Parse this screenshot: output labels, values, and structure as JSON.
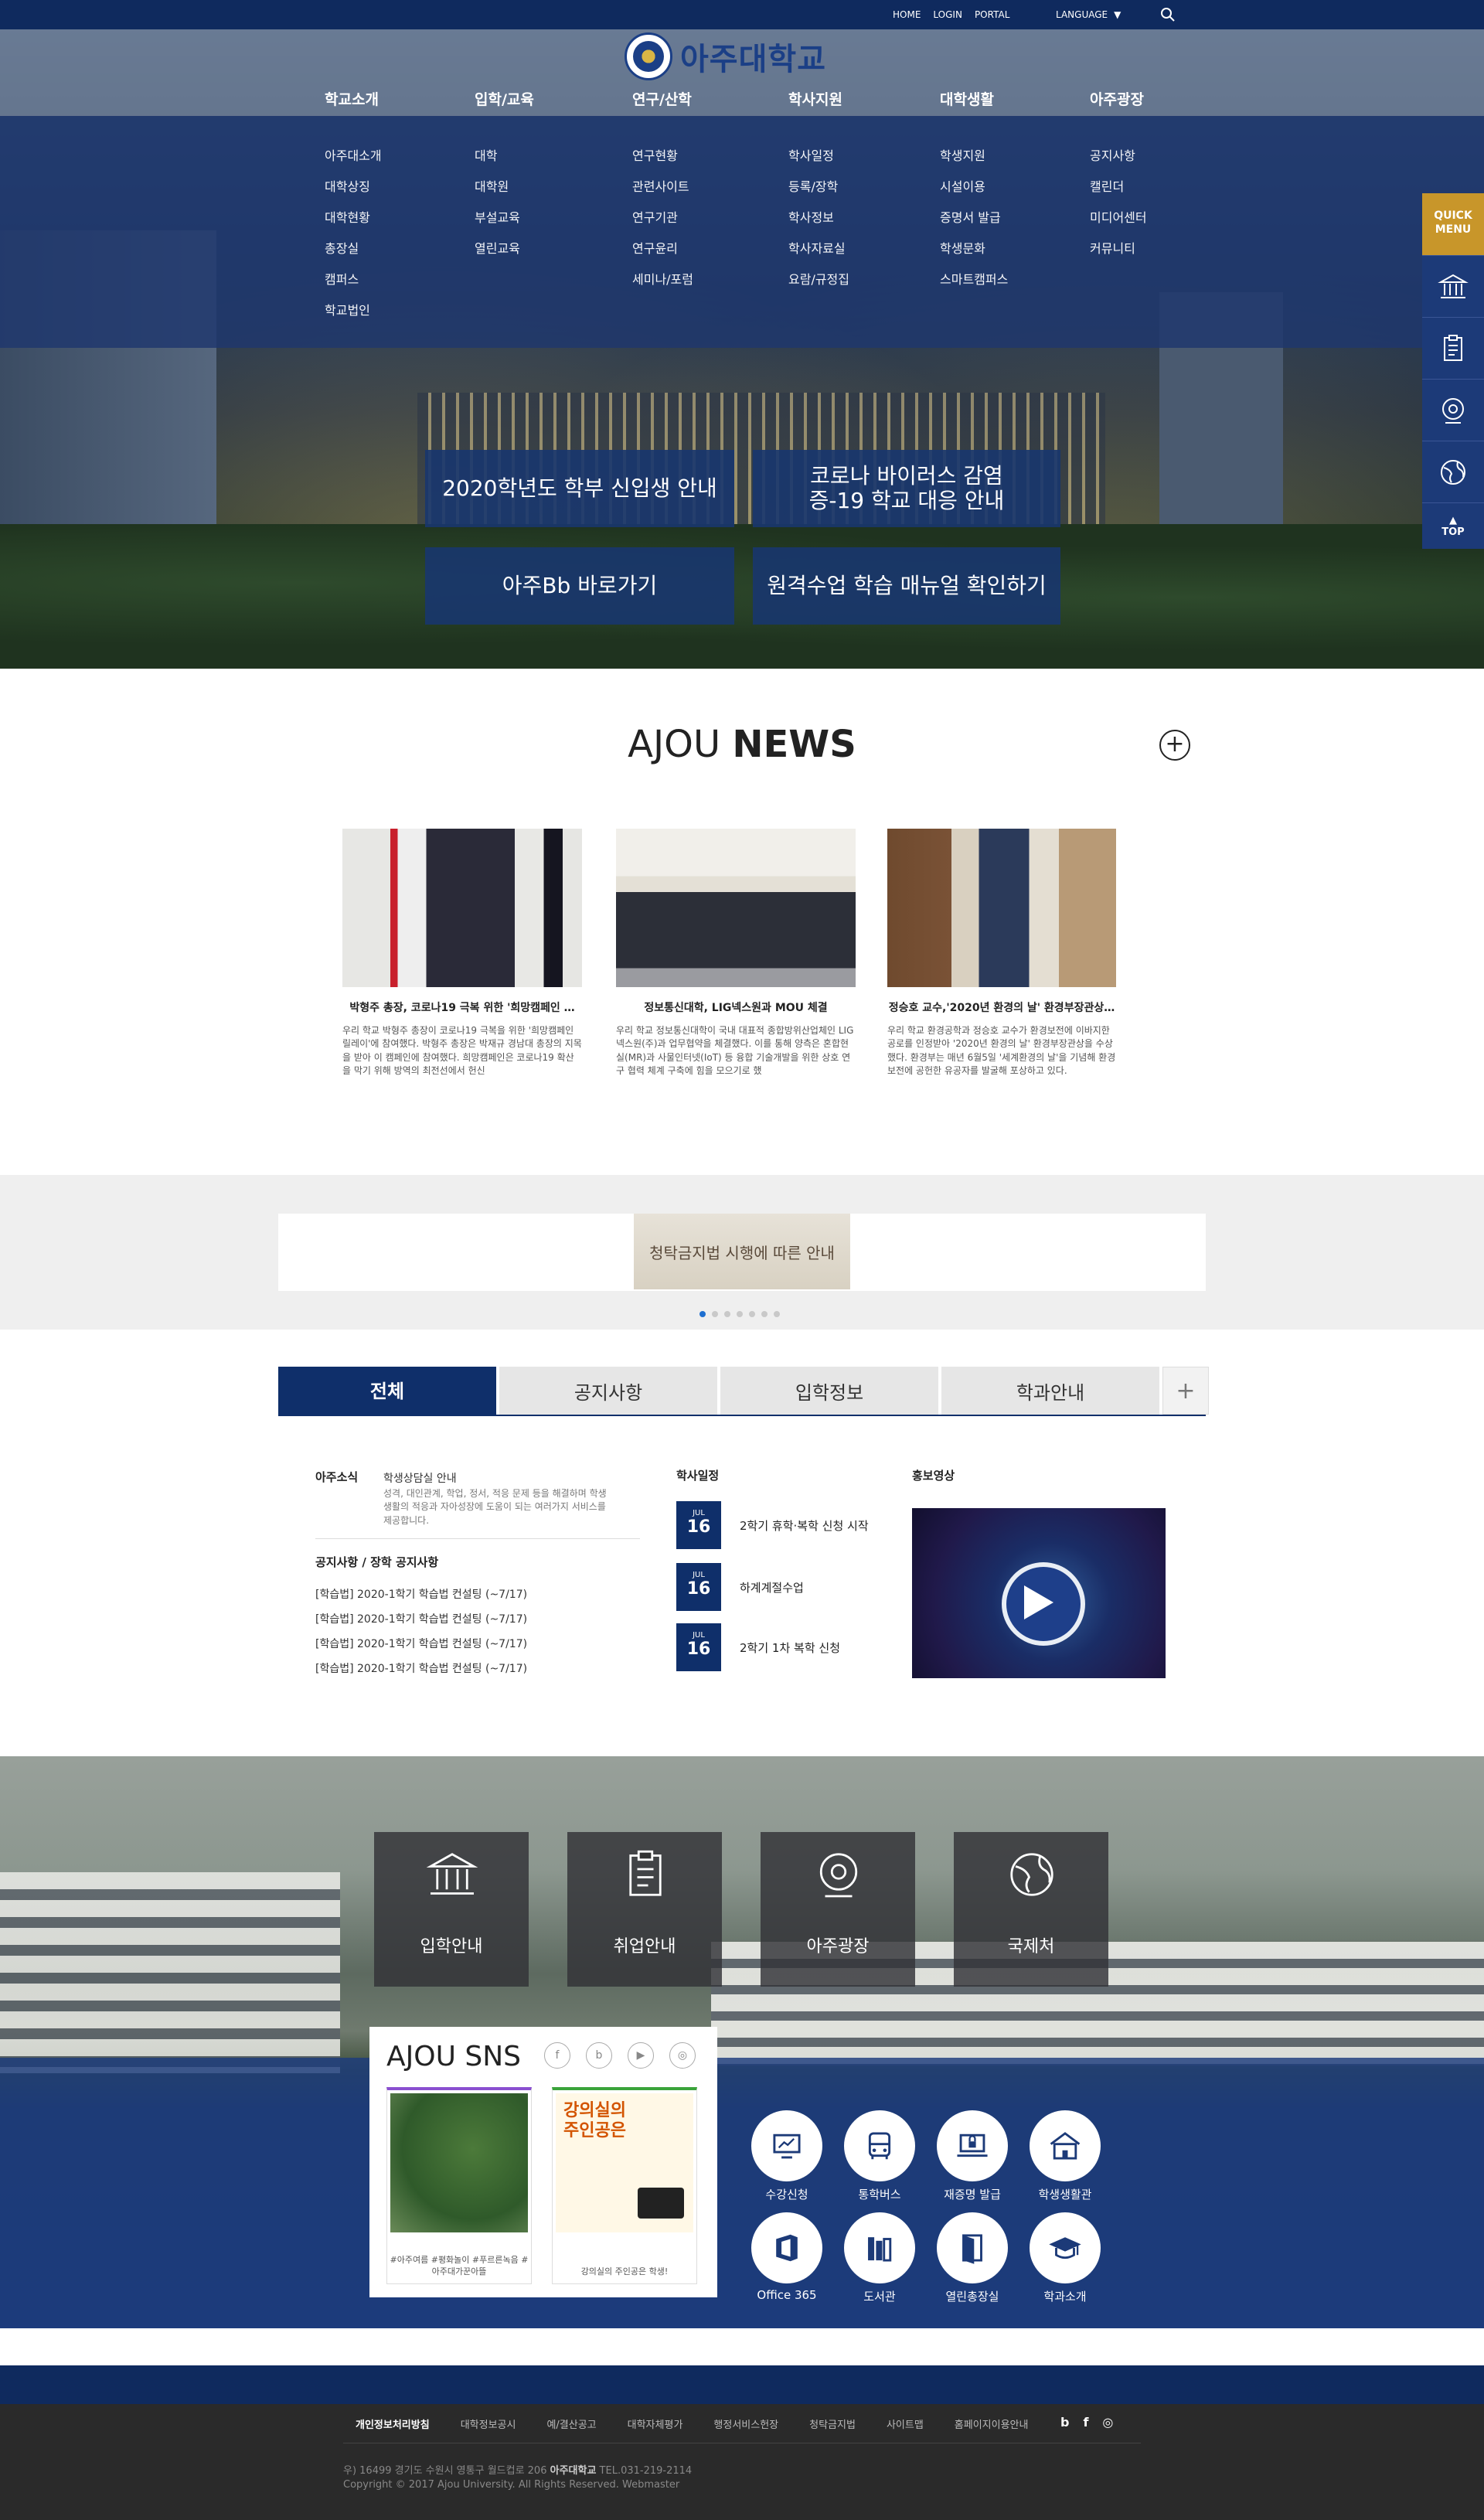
{
  "topbar": {
    "links": [
      "HOME",
      "LOGIN",
      "PORTAL"
    ],
    "language": "LANGUAGE"
  },
  "logo": {
    "name": "아주대학교"
  },
  "gnb": [
    {
      "head": "학교소개",
      "items": [
        "아주대소개",
        "대학상징",
        "대학현황",
        "총장실",
        "캠퍼스",
        "학교법인"
      ]
    },
    {
      "head": "입학/교육",
      "items": [
        "대학",
        "대학원",
        "부설교육",
        "열린교육"
      ]
    },
    {
      "head": "연구/산학",
      "items": [
        "연구현황",
        "관련사이트",
        "연구기관",
        "연구윤리",
        "세미나/포럼"
      ]
    },
    {
      "head": "학사지원",
      "items": [
        "학사일정",
        "등록/장학",
        "학사정보",
        "학사자료실",
        "요람/규정집"
      ]
    },
    {
      "head": "대학생활",
      "items": [
        "학생지원",
        "시설이용",
        "증명서 발급",
        "학생문화",
        "스마트캠퍼스"
      ]
    },
    {
      "head": "아주광장",
      "items": [
        "공지사항",
        "캘린더",
        "미디어센터",
        "커뮤니티"
      ]
    }
  ],
  "hero_buttons": [
    "2020학년도 학부 신입생 안내",
    "코로나 바이러스 감염증-19 학교 대응 안내",
    "아주Bb 바로가기",
    "원격수업 학습 매뉴얼 확인하기"
  ],
  "quick": {
    "title": "QUICK MENU",
    "icons": [
      "university-icon",
      "clipboard-icon",
      "webcam-icon",
      "globe-icon"
    ],
    "top": "TOP"
  },
  "news": {
    "title_light": "AJOU ",
    "title_bold": "NEWS",
    "items": [
      {
        "title": "박형주 총장, 코로나19 극복 위한 '희망캠페인 …",
        "desc": "우리 학교 박형주 총장이 코로나19 극복을 위한 '희망캠페인 릴레이'에 참여했다. 박형주 총장은 박재규 경남대 총장의 지목을 받아 이 캠페인에 참여했다. 희망캠페인은 코로나19 확산을 막기 위해 방역의 최전선에서 헌신"
      },
      {
        "title": "정보통신대학, LIG넥스원과 MOU 체결",
        "desc": "우리 학교 정보통신대학이 국내 대표적 종합방위산업체인 LIG넥스원(주)과 업무협약을 체결했다. 이를 통해 양측은 혼합현실(MR)과 사물인터넷(IoT) 등 융합 기술개발을 위한 상호 연구 협력 체계 구축에 힘을 모으기로 했"
      },
      {
        "title": "정승호 교수,'2020년 환경의 날' 환경부장관상…",
        "desc": "우리 학교 환경공학과 정승호 교수가 환경보전에 이바지한 공로를 인정받아 '2020년 환경의 날' 환경부장관상을 수상했다. 환경부는 매년 6월5일 '세계환경의 날'을 기념해 환경보전에 공헌한 유공자를 발굴해 포상하고 있다."
      }
    ]
  },
  "banner": {
    "text": "청탁금지법 시행에 따른 안내",
    "dots": 7,
    "active": 0
  },
  "tabs": [
    "전체",
    "공지사항",
    "입학정보",
    "학과안내"
  ],
  "info": {
    "ajou_news_label": "아주소식",
    "ajou_news_title": "학생상담실 안내",
    "ajou_news_desc": "성격, 대인관계, 학업, 정서, 적응 문제 등을 해결하며 학생생활의 적응과 자아성장에 도움이 되는 여러가지 서비스를 제공합니다.",
    "notice_title": "공지사항 / 장학 공지사항",
    "notices": [
      "[학습법] 2020-1학기 학습법 컨설팅 (~7/17)",
      "[학습법] 2020-1학기 학습법 컨설팅 (~7/17)",
      "[학습법] 2020-1학기 학습법 컨설팅 (~7/17)",
      "[학습법] 2020-1학기 학습법 컨설팅 (~7/17)"
    ],
    "schedule_title": "학사일정",
    "schedule": [
      {
        "month": "JUL",
        "day": "16",
        "text": "2학기 휴학·복학 신청 시작"
      },
      {
        "month": "JUL",
        "day": "16",
        "text": "하계계절수업"
      },
      {
        "month": "JUL",
        "day": "16",
        "text": "2학기 1차 복학 신청"
      }
    ],
    "video_title": "홍보영상"
  },
  "tiles": [
    {
      "label": "입학안내",
      "icon": "university-icon"
    },
    {
      "label": "취업안내",
      "icon": "clipboard-icon"
    },
    {
      "label": "아주광장",
      "icon": "webcam-icon"
    },
    {
      "label": "국제처",
      "icon": "globe-icon"
    }
  ],
  "sns": {
    "title": "AJOU SNS",
    "icons": [
      "f",
      "b",
      "▶",
      "◎"
    ],
    "cards": [
      {
        "caption": "#아주여름 #평화놀이 #푸르른녹음 #아주대가꾼아뜰"
      },
      {
        "heading": "강의실의 주인공은",
        "caption": "강의실의 주인공은 학생!"
      }
    ]
  },
  "services": [
    "수강신청",
    "통학버스",
    "재증명 발급",
    "학생생활관",
    "Office 365",
    "도서관",
    "열린총장실",
    "학과소개"
  ],
  "footer": {
    "links": [
      "개인정보처리방침",
      "대학정보공시",
      "예/결산공고",
      "대학자체평가",
      "행정서비스헌장",
      "청탁금지법",
      "사이트맵",
      "홈페이지이용안내"
    ],
    "sns": [
      "b",
      "f",
      "◎"
    ],
    "addr_prefix": "우) 16499 경기도 수원시 영통구 월드컵로 206 ",
    "addr_bold": "아주대학교",
    "addr_tel": " TEL.031-219-2114",
    "copyright": "Copyright © 2017 Ajou University. All Rights Reserved. Webmaster"
  },
  "colors": {
    "navy": "#0f2a5e",
    "gold": "#c8962a",
    "accent": "#1e6fd0"
  }
}
